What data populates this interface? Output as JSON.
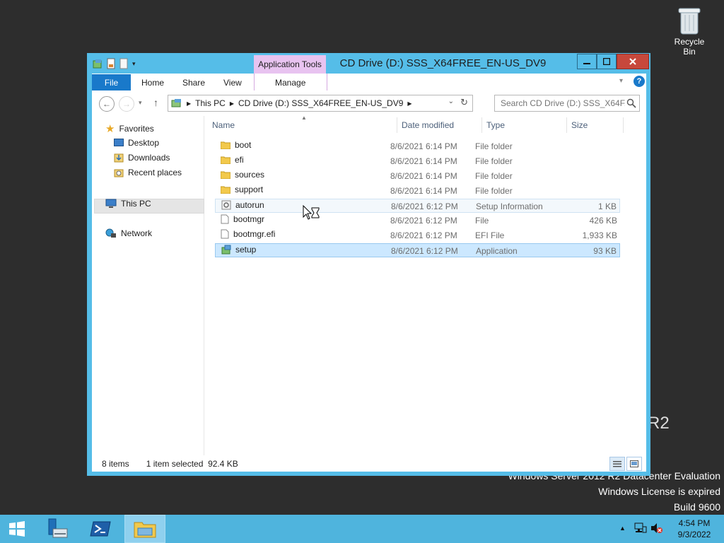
{
  "desktop": {
    "recycle_bin_label": "Recycle Bin",
    "watermark_lines": [
      "Windows Server 2012 R2 Datacenter Evaluation",
      "Windows License is expired",
      "Build 9600"
    ],
    "r2_partial": "R2"
  },
  "window": {
    "title": "CD Drive (D:) SSS_X64FREE_EN-US_DV9",
    "contextual_tab_group": "Application Tools",
    "controls": {
      "minimize": "—",
      "maximize": "☐",
      "close": "✕"
    }
  },
  "ribbon": {
    "tabs": {
      "file": "File",
      "home": "Home",
      "share": "Share",
      "view": "View",
      "manage": "Manage"
    }
  },
  "address_bar": {
    "breadcrumbs": [
      "This PC",
      "CD Drive (D:) SSS_X64FREE_EN-US_DV9"
    ],
    "search_placeholder": "Search CD Drive (D:) SSS_X64F..."
  },
  "nav_pane": {
    "favorites": "Favorites",
    "desktop": "Desktop",
    "downloads": "Downloads",
    "recent_places": "Recent places",
    "this_pc": "This PC",
    "network": "Network"
  },
  "file_list": {
    "columns": {
      "name": "Name",
      "date": "Date modified",
      "type": "Type",
      "size": "Size"
    },
    "rows": [
      {
        "name": "boot",
        "date": "8/6/2021 6:14 PM",
        "type": "File folder",
        "size": "",
        "icon": "folder-icon"
      },
      {
        "name": "efi",
        "date": "8/6/2021 6:14 PM",
        "type": "File folder",
        "size": "",
        "icon": "folder-icon"
      },
      {
        "name": "sources",
        "date": "8/6/2021 6:14 PM",
        "type": "File folder",
        "size": "",
        "icon": "folder-icon"
      },
      {
        "name": "support",
        "date": "8/6/2021 6:14 PM",
        "type": "File folder",
        "size": "",
        "icon": "folder-icon"
      },
      {
        "name": "autorun",
        "date": "8/6/2021 6:12 PM",
        "type": "Setup Information",
        "size": "1 KB",
        "icon": "setup-info-icon"
      },
      {
        "name": "bootmgr",
        "date": "8/6/2021 6:12 PM",
        "type": "File",
        "size": "426 KB",
        "icon": "file-icon"
      },
      {
        "name": "bootmgr.efi",
        "date": "8/6/2021 6:12 PM",
        "type": "EFI File",
        "size": "1,933 KB",
        "icon": "file-icon"
      },
      {
        "name": "setup",
        "date": "8/6/2021 6:12 PM",
        "type": "Application",
        "size": "93 KB",
        "icon": "setup-app-icon"
      }
    ]
  },
  "status_bar": {
    "item_count": "8 items",
    "selection": "1 item selected  92.4 KB"
  },
  "taskbar": {
    "time": "4:54 PM",
    "date": "9/3/2022"
  },
  "colors": {
    "window_frame": "#55bde8",
    "file_tab": "#1979ca",
    "contextual_tab": "#e8c3f0",
    "selection": "#cce8ff",
    "close_button": "#c7483c",
    "taskbar": "#4fb4dd"
  }
}
